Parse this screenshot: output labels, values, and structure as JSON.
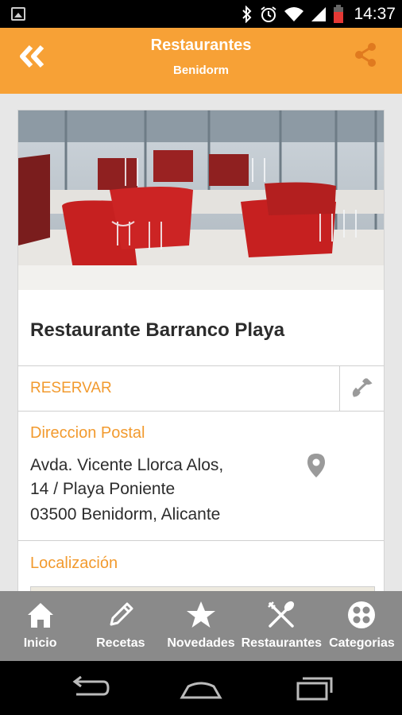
{
  "status_bar": {
    "time": "14:37"
  },
  "app_bar": {
    "title": "Restaurantes",
    "subtitle": "Benidorm",
    "back_icon": "double-chevron-left-icon",
    "share_icon": "share-icon"
  },
  "restaurant": {
    "name": "Restaurante Barranco Playa",
    "reserve_label": "RESERVAR",
    "address_heading": "Direccion Postal",
    "address_line1": "Avda. Vicente Llorca Alos,",
    "address_line2": "14 / Playa Poniente",
    "address_line3": "03500 Benidorm, Alicante",
    "location_heading": "Localización"
  },
  "bottom_nav": [
    {
      "label": "Inicio",
      "icon": "home-icon"
    },
    {
      "label": "Recetas",
      "icon": "pencil-icon"
    },
    {
      "label": "Novedades",
      "icon": "star-icon"
    },
    {
      "label": "Restaurantes",
      "icon": "fork-knife-icon"
    },
    {
      "label": "Categorias",
      "icon": "grid-dots-icon"
    }
  ],
  "colors": {
    "accent": "#f7a136",
    "accent_text": "#f29a2e",
    "nav_bg": "#8a8a8a",
    "page_bg": "#e7e7e7"
  }
}
